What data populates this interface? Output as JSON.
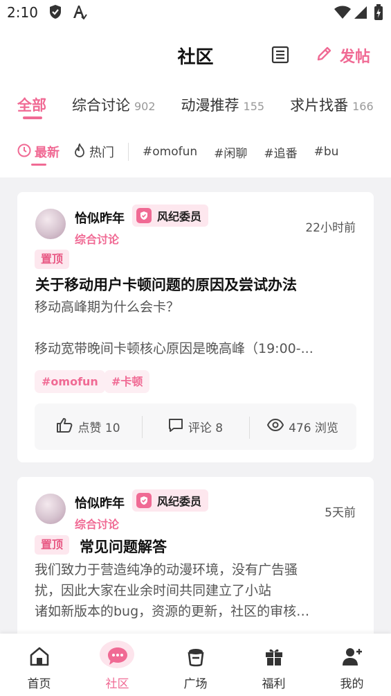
{
  "status": {
    "time": "2:10"
  },
  "header": {
    "title": "社区",
    "post_label": "发帖"
  },
  "tabs": [
    {
      "label": "全部",
      "count": ""
    },
    {
      "label": "综合讨论",
      "count": "902"
    },
    {
      "label": "动漫推荐",
      "count": "155"
    },
    {
      "label": "求片找番",
      "count": "166"
    }
  ],
  "filters": {
    "latest": "最新",
    "hot": "热门"
  },
  "topic_tags": [
    "#omofun",
    "#闲聊",
    "#追番",
    "#bu"
  ],
  "posts": [
    {
      "user": "恰似昨年",
      "badge": "风纪委员",
      "category": "综合讨论",
      "time": "22小时前",
      "pin": "置顶",
      "title": "关于移动用户卡顿问题的原因及尝试办法",
      "body": [
        "移动高峰期为什么会卡？",
        "",
        "移动宽带晚间卡顿核心原因是晚高峰（19:00-..."
      ],
      "tags": [
        "#omofun",
        "#卡顿"
      ],
      "likes": "点赞 10",
      "comments": "评论 8",
      "views": "476 浏览"
    },
    {
      "user": "恰似昨年",
      "badge": "风纪委员",
      "category": "综合讨论",
      "time": "5天前",
      "pin": "置顶",
      "title": "常见问题解答",
      "body": [
        "我们致力于营造纯净的动漫环境，没有广告骚",
        "扰，因此大家在业余时间共同建立了小站",
        "诸如新版本的bug，资源的更新，社区的审核…"
      ]
    }
  ],
  "nav": [
    {
      "label": "首页"
    },
    {
      "label": "社区"
    },
    {
      "label": "广场"
    },
    {
      "label": "福利"
    },
    {
      "label": "我的"
    }
  ],
  "colors": {
    "accent": "#f06a94",
    "badge_bg": "#fde7ee",
    "page_bg": "#f2f2f4"
  }
}
